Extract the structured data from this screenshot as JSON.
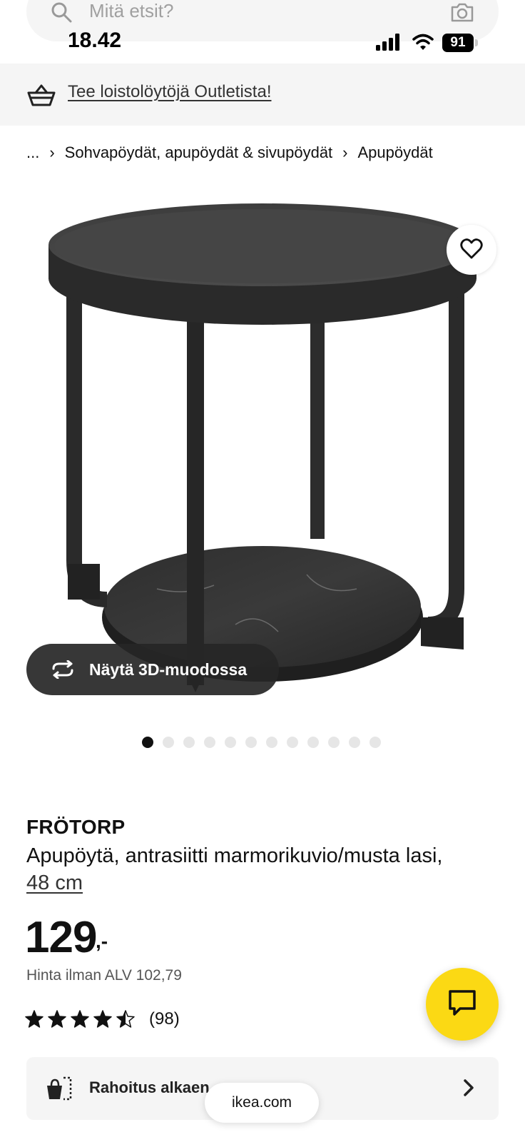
{
  "search": {
    "placeholder": "Mitä etsit?"
  },
  "status_bar": {
    "time": "18.42",
    "battery": "91"
  },
  "promo": {
    "text": "Tee loistolöytöjä Outletista!"
  },
  "breadcrumb": [
    {
      "label": "..."
    },
    {
      "label": "Sohvapöydät, apupöydät & sivupöydät"
    },
    {
      "label": "Apupöydät"
    }
  ],
  "media": {
    "view3d_label": "Näytä 3D-muodossa",
    "image_count": 12,
    "active_image": 1
  },
  "product": {
    "name": "FRÖTORP",
    "description": "Apupöytä, antrasiitti marmorikuvio/musta lasi,",
    "size": "48 cm",
    "price": "129",
    "price_suffix": ",-",
    "price_without_vat": "Hinta ilman ALV 102,79",
    "rating": 4.5,
    "rating_max": 5,
    "review_count": "(98)"
  },
  "financing": {
    "label": "Rahoitus alkaen"
  },
  "browser": {
    "url": "ikea.com"
  },
  "colors": {
    "ikea_yellow": "#fbd914",
    "dark": "#111111",
    "surface": "#f5f5f5"
  }
}
